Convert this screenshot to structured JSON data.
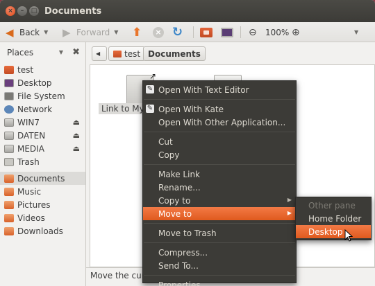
{
  "window": {
    "title": "Documents"
  },
  "toolbar": {
    "back_label": "Back",
    "forward_label": "Forward",
    "zoom_level": "100%"
  },
  "sidebar": {
    "heading": "Places",
    "items": [
      {
        "label": "test",
        "icon": "home-folder-icon"
      },
      {
        "label": "Desktop",
        "icon": "desktop-icon"
      },
      {
        "label": "File System",
        "icon": "harddisk-icon"
      },
      {
        "label": "Network",
        "icon": "network-icon"
      },
      {
        "label": "WIN7",
        "icon": "drive-icon",
        "eject": true
      },
      {
        "label": "DATEN",
        "icon": "drive-icon",
        "eject": true
      },
      {
        "label": "MEDIA",
        "icon": "drive-icon",
        "eject": true
      },
      {
        "label": "Trash",
        "icon": "trash-icon"
      },
      {
        "label": "Documents",
        "icon": "folder-icon",
        "selected": true
      },
      {
        "label": "Music",
        "icon": "music-folder-icon"
      },
      {
        "label": "Pictures",
        "icon": "pictures-folder-icon"
      },
      {
        "label": "Videos",
        "icon": "videos-folder-icon"
      },
      {
        "label": "Downloads",
        "icon": "downloads-folder-icon"
      }
    ]
  },
  "pathbar": {
    "crumbs": [
      "test",
      "Documents"
    ]
  },
  "content": {
    "selected_file_label": "Link to My"
  },
  "status": {
    "text": "Move the curr"
  },
  "context_menu": {
    "items": [
      {
        "label": "Open With Text Editor",
        "icon": "text-editor-icon"
      },
      {
        "label": "Open With Kate",
        "icon": "kate-icon"
      },
      {
        "label": "Open With Other Application..."
      },
      {
        "label": "Cut"
      },
      {
        "label": "Copy"
      },
      {
        "label": "Make Link"
      },
      {
        "label": "Rename..."
      },
      {
        "label": "Copy to",
        "submenu": true
      },
      {
        "label": "Move to",
        "submenu": true,
        "highlighted": true
      },
      {
        "label": "Move to Trash"
      },
      {
        "label": "Compress..."
      },
      {
        "label": "Send To..."
      },
      {
        "label": "Properties"
      }
    ]
  },
  "submenu": {
    "items": [
      {
        "label": "Other pane",
        "disabled": true
      },
      {
        "label": "Home Folder"
      },
      {
        "label": "Desktop",
        "highlighted": true
      }
    ]
  },
  "colors": {
    "accent": "#e9622a",
    "menu_bg": "#3c3b37",
    "titlebar_bg": "#3c3b37"
  }
}
